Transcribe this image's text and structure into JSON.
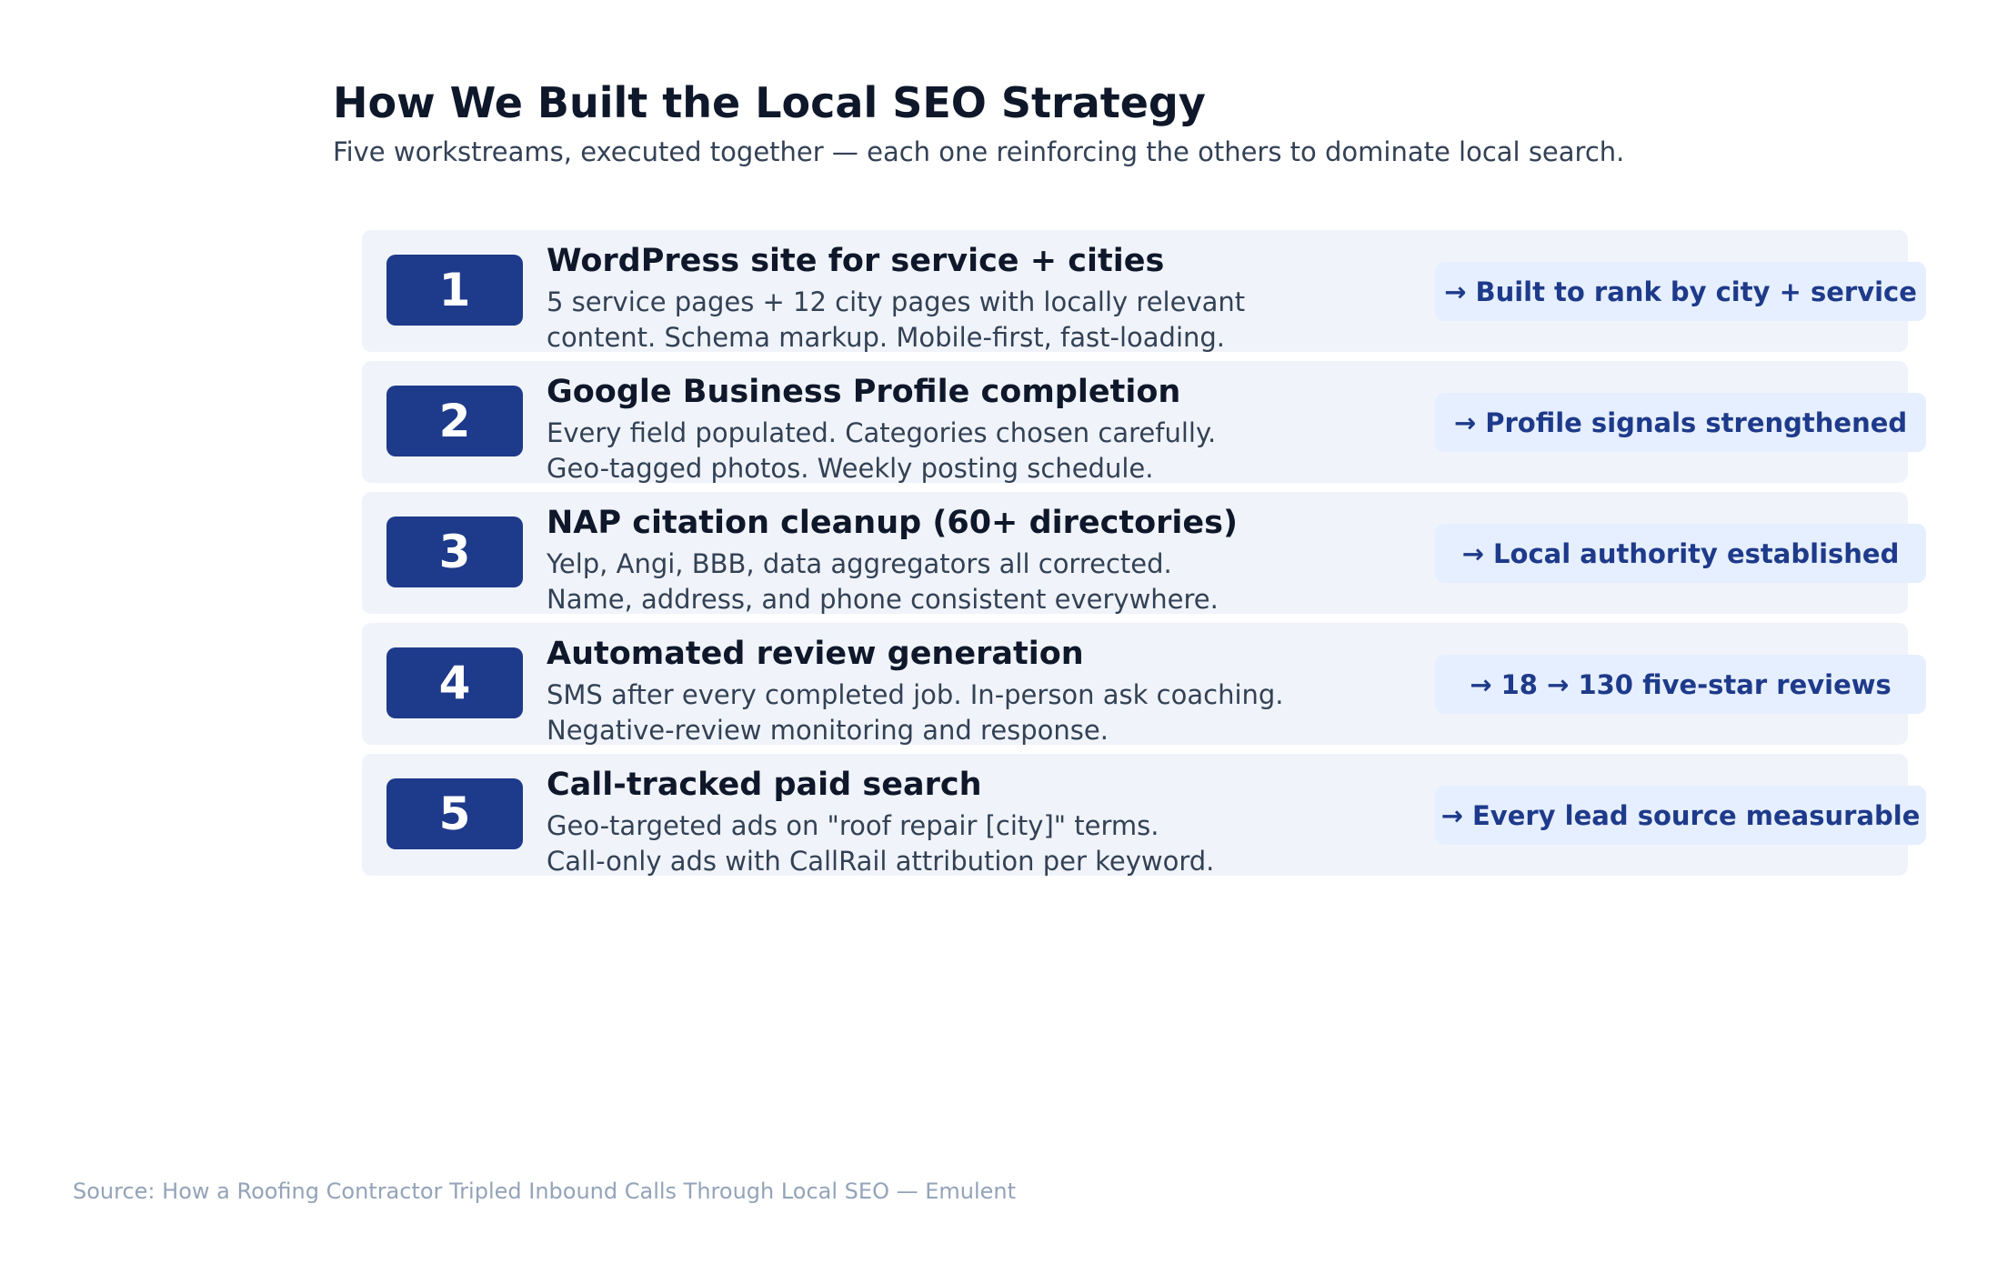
{
  "title": "How We Built the Local SEO Strategy",
  "subtitle": "Five workstreams, executed together — each one reinforcing the others to dominate local search.",
  "steps": [
    {
      "number": "1",
      "title": "WordPress site for service + cities",
      "desc_lines": [
        "5 service pages + 12 city pages with locally relevant",
        "content. Schema markup. Mobile-first, fast-loading."
      ],
      "outcome": "→  Built to rank by city + service"
    },
    {
      "number": "2",
      "title": "Google Business Profile completion",
      "desc_lines": [
        "Every field populated. Categories chosen carefully.",
        "Geo-tagged photos. Weekly posting schedule."
      ],
      "outcome": "→  Profile signals strengthened"
    },
    {
      "number": "3",
      "title": "NAP citation cleanup (60+ directories)",
      "desc_lines": [
        "Yelp, Angi, BBB, data aggregators all corrected.",
        "Name, address, and phone consistent everywhere."
      ],
      "outcome": "→  Local authority established"
    },
    {
      "number": "4",
      "title": "Automated review generation",
      "desc_lines": [
        "SMS after every completed job. In-person ask coaching.",
        "Negative-review monitoring and response."
      ],
      "outcome": "→  18 → 130 five-star reviews"
    },
    {
      "number": "5",
      "title": "Call-tracked paid search",
      "desc_lines": [
        "Geo-targeted ads on \"roof repair [city]\" terms.",
        "Call-only ads with CallRail attribution per keyword."
      ],
      "outcome": "→  Every lead source measurable"
    }
  ],
  "source": "Source: How a Roofing Contractor Tripled Inbound Calls Through Local SEO — Emulent",
  "colors": {
    "badge": "#1e3a8a",
    "card": "#f0f4fa",
    "pill": "#e6efff",
    "title": "#0f172a",
    "body": "#334155",
    "source": "#94a3b8"
  }
}
